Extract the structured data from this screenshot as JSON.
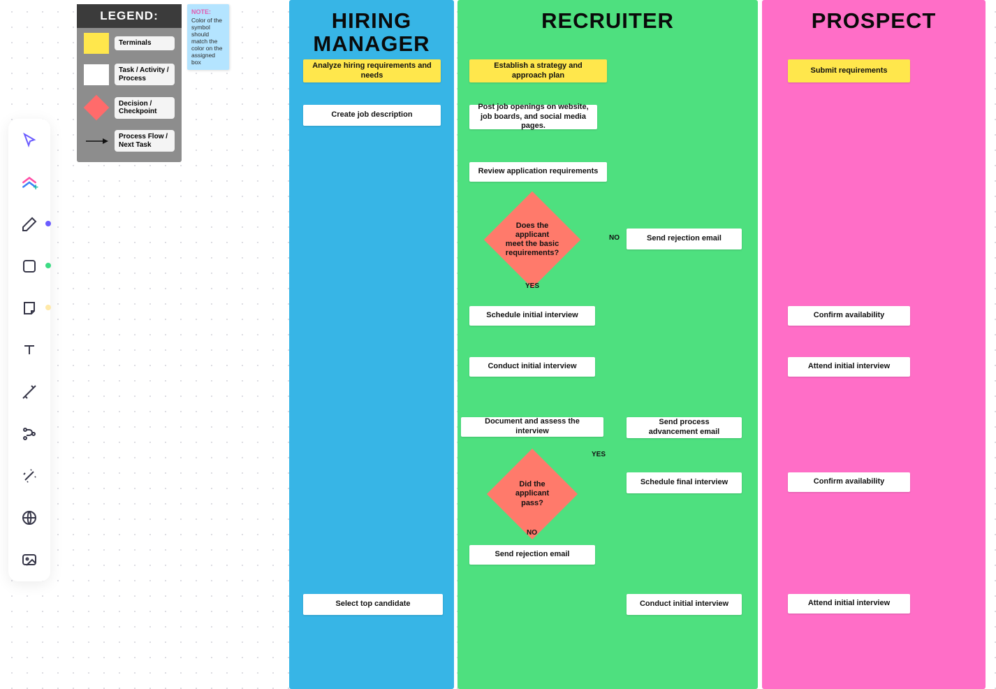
{
  "legend": {
    "title": "LEGEND:",
    "items": [
      {
        "label": "Terminals"
      },
      {
        "label": "Task / Activity / Process"
      },
      {
        "label": "Decision / Checkpoint"
      },
      {
        "label": "Process Flow / Next Task"
      }
    ]
  },
  "note": {
    "title": "NOTE:",
    "body": "Color of the symbol should match the color on the assigned box"
  },
  "lanes": {
    "hiring_manager": "HIRING MANAGER",
    "recruiter": "RECRUITER",
    "prospect": "PROSPECT"
  },
  "nodes": {
    "hm_analyze": "Analyze hiring requirements and needs",
    "hm_create_jd": "Create job description",
    "hm_select_top": "Select top candidate",
    "rc_strategy": "Establish a strategy and approach plan",
    "rc_post": "Post job openings on website, job boards, and social media pages.",
    "rc_review": "Review application requirements",
    "rc_dec_basic": "Does the applicant meet the basic requirements?",
    "rc_reject1": "Send rejection email",
    "rc_sched_initial": "Schedule initial interview",
    "rc_conduct_initial": "Conduct initial interview",
    "rc_document": "Document and assess the interview",
    "rc_dec_pass": "Did the applicant pass?",
    "rc_reject2": "Send rejection email",
    "rc_advance": "Send process advancement email",
    "rc_sched_final": "Schedule final interview",
    "rc_conduct_initial2": "Conduct initial interview",
    "pr_submit": "Submit requirements",
    "pr_confirm1": "Confirm availability",
    "pr_attend1": "Attend initial interview",
    "pr_confirm2": "Confirm availability",
    "pr_attend2": "Attend initial interview"
  },
  "edge_labels": {
    "no1": "NO",
    "yes1": "YES",
    "yes2": "YES",
    "no2": "NO"
  }
}
